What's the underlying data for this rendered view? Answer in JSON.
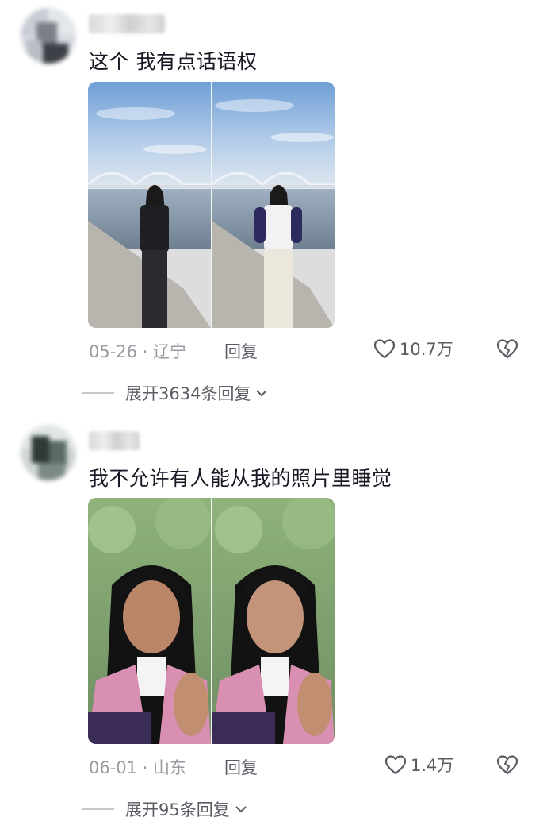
{
  "comments": [
    {
      "text": "这个 我有点话语权",
      "date_location": "05-26 · 辽宁",
      "reply_label": "回复",
      "likes": "10.7万",
      "expand_label": "展开3634条回复"
    },
    {
      "text": "我不允许有人能从我的照片里睡觉",
      "date_location": "06-01 · 山东",
      "reply_label": "回复",
      "likes": "1.4万",
      "expand_label": "展开95条回复"
    }
  ],
  "colors": {
    "primary_text": "#161823",
    "secondary_text": "#9a9ba0",
    "action_text": "#5a5b63"
  },
  "icons": [
    "heart-icon",
    "broken-heart-icon",
    "chevron-down-icon"
  ]
}
